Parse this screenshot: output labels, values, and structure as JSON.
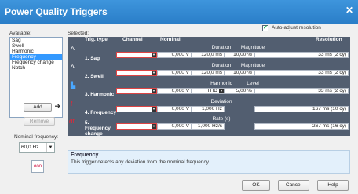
{
  "window": {
    "title": "Power Quality Triggers"
  },
  "available": {
    "label": "Available:",
    "items": [
      "Sag",
      "Swell",
      "Harmonic",
      "Frequency",
      "Frequency change",
      "Notch"
    ],
    "selected_index": 3
  },
  "buttons": {
    "add": "Add",
    "remove": "Remove",
    "ok": "OK",
    "cancel": "Cancel",
    "help": "Help"
  },
  "nominal_frequency": {
    "label": "Nominal frequency:",
    "value": "60,0 Hz"
  },
  "selected": {
    "label": "Selected:"
  },
  "auto_adjust": {
    "label": "Auto-adjust resolution",
    "checked": true
  },
  "grid": {
    "headers": {
      "trig_type": "Trig. type",
      "channel": "Channel",
      "nominal": "Nominal",
      "resolution": "Resolution"
    },
    "rows": [
      {
        "name": "1. Sag",
        "nominal": "0,000 V",
        "sub1": "Duration",
        "val1": "120,0 ms",
        "sub2": "Magnitude",
        "val2": "10,00 %",
        "resolution": "33 ms (2 cy)"
      },
      {
        "name": "2. Swell",
        "nominal": "0,000 V",
        "sub1": "Duration",
        "val1": "120,0 ms",
        "sub2": "Magnitude",
        "val2": "10,00 %",
        "resolution": "33 ms (2 cy)"
      },
      {
        "name": "3. Harmonic",
        "nominal": "0,000 V",
        "sub1": "Harmonic",
        "val1": "THD",
        "sub2": "Level",
        "val2": "5,00 %",
        "resolution": "33 ms (2 cy)"
      },
      {
        "name": "4. Frequency",
        "nominal": "0,000 V",
        "sub1": "Deviation",
        "val1": "1,000 Hz",
        "sub2": "",
        "val2": "",
        "resolution": "167 ms (10 cy)"
      },
      {
        "name": "5. Frequency change",
        "nominal": "0,000 V",
        "sub1": "Rate (s)",
        "val1": "1,000 Hz/s",
        "sub2": "",
        "val2": "",
        "resolution": "267 ms (16 cy)"
      }
    ]
  },
  "description": {
    "title": "Frequency",
    "text": "This trigger detects any deviation from the nominal frequency"
  },
  "colors": {
    "title_bar": "#2a7ec8",
    "grid_bg": "#525e70",
    "selection": "#3399ff",
    "description_bg": "#e3f0fb"
  }
}
